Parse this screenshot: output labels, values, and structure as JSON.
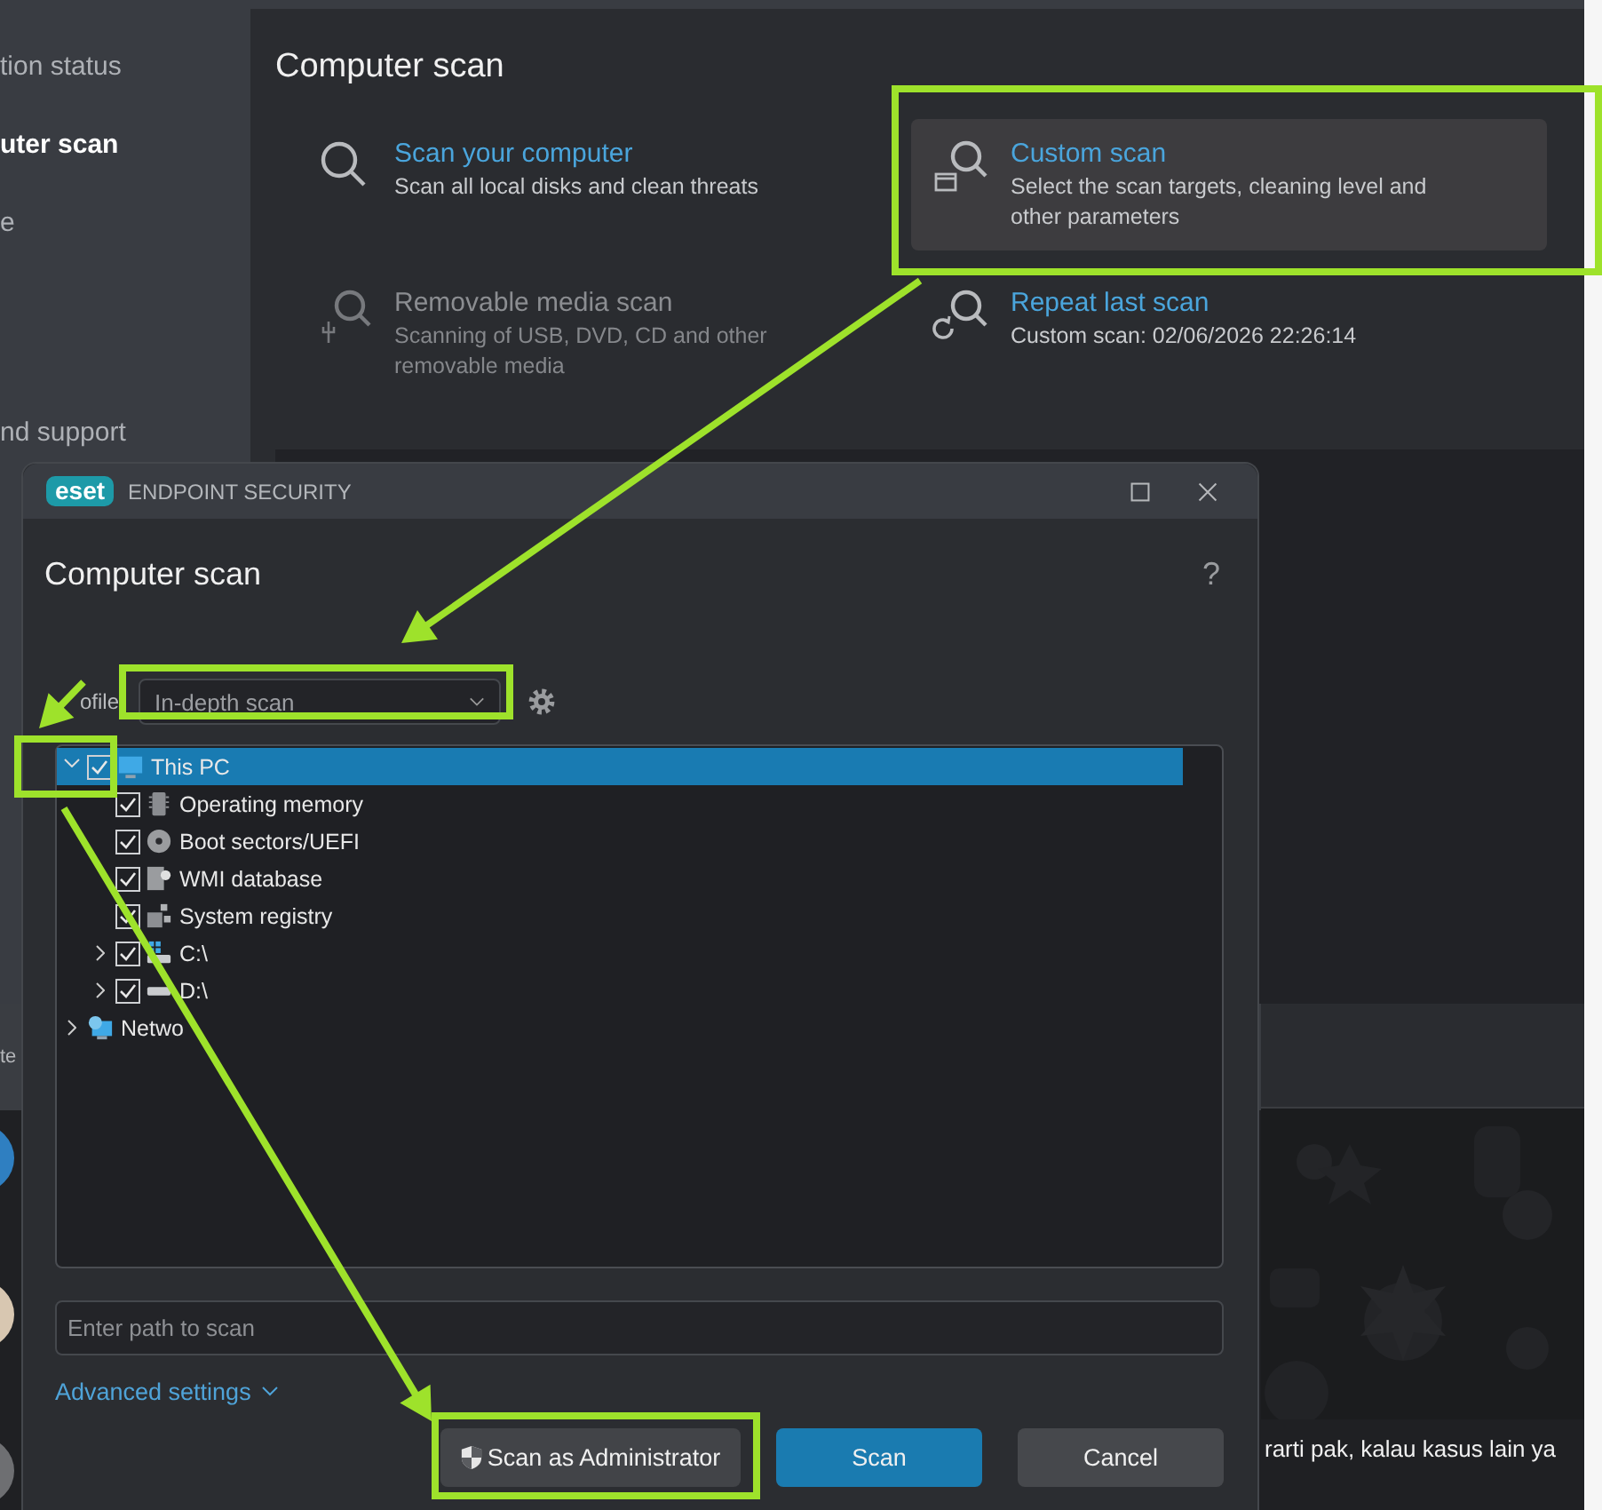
{
  "sidebar": {
    "items": [
      {
        "label": "tion status",
        "selected": false
      },
      {
        "label": "uter scan",
        "selected": true
      },
      {
        "label": "e",
        "selected": false
      },
      {
        "label": "nd support",
        "selected": false
      }
    ]
  },
  "main": {
    "title": "Computer scan",
    "options": [
      {
        "kind": "computer",
        "title": "Scan your computer",
        "description": "Scan all local disks and clean threats",
        "disabled": false,
        "selected": false
      },
      {
        "kind": "custom",
        "title": "Custom scan",
        "description": "Select the scan targets, cleaning level and other parameters",
        "disabled": false,
        "selected": true
      },
      {
        "kind": "removable",
        "title": "Removable media scan",
        "description": "Scanning of USB, DVD, CD and other removable media",
        "disabled": true,
        "selected": false
      },
      {
        "kind": "repeat",
        "title": "Repeat last scan",
        "description": "Custom scan: 02/06/2026 22:26:14",
        "disabled": false,
        "selected": false
      }
    ]
  },
  "dialog": {
    "logo": "eset",
    "app_name": "ENDPOINT SECURITY",
    "title": "Computer scan",
    "help": "?",
    "profile": {
      "label": "ofile",
      "value": "In-depth scan"
    },
    "tree": [
      {
        "kind": "computer",
        "label": "This PC",
        "expanded": true,
        "checked": true,
        "selected": true,
        "children": [
          {
            "kind": "memory",
            "label": "Operating memory",
            "checked": true,
            "selected": false
          },
          {
            "kind": "boot",
            "label": "Boot sectors/UEFI",
            "checked": true,
            "selected": false
          },
          {
            "kind": "wmi",
            "label": "WMI database",
            "checked": true,
            "selected": false
          },
          {
            "kind": "registry",
            "label": "System registry",
            "checked": true,
            "selected": false
          },
          {
            "kind": "system-drive",
            "label": "C:\\",
            "expanded": false,
            "checked": true,
            "selected": false
          },
          {
            "kind": "drive",
            "label": "D:\\",
            "expanded": false,
            "checked": true,
            "selected": false
          }
        ]
      },
      {
        "kind": "network",
        "label": "Netwo",
        "expanded": false,
        "selected": false
      }
    ],
    "path_field": {
      "placeholder": "Enter path to scan"
    },
    "advanced_link": "Advanced settings",
    "buttons": [
      {
        "kind": "admin",
        "label": "Scan as Administrator"
      },
      {
        "kind": "primary",
        "label": "Scan"
      },
      {
        "kind": "secondary",
        "label": "Cancel"
      }
    ]
  },
  "chat": {
    "list_header": "te",
    "message": "rarti pak, kalau kasus lain ya"
  }
}
